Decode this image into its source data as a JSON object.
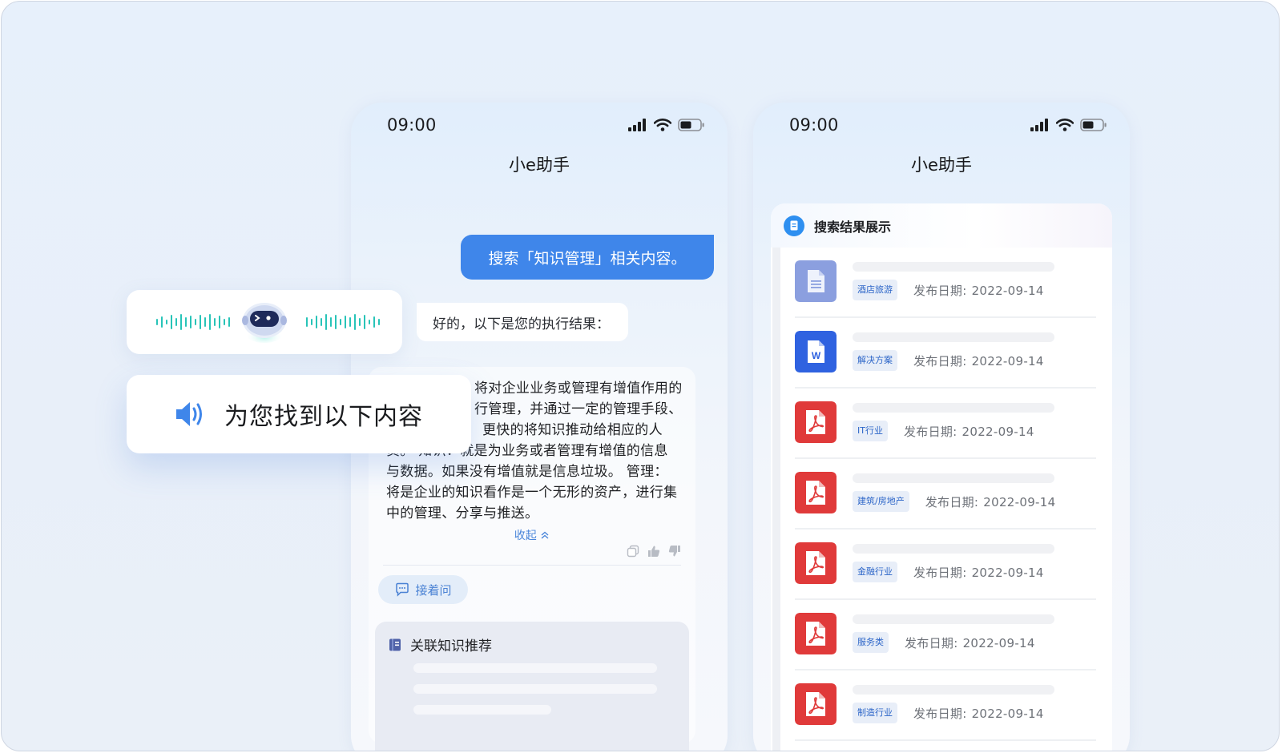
{
  "colors": {
    "accent": "#3f86ea",
    "pdf": "#e03a3a",
    "word": "#2f62e0",
    "doc": "#8aa0e0",
    "tag_text": "#2d66c8",
    "waveform": "#28c4b8"
  },
  "status_bar": {
    "time": "09:00"
  },
  "left_phone": {
    "title": "小e助手",
    "user_message": "搜索「知识管理」相关内容。",
    "bot_reply": "好的，以下是您的执行结果：",
    "answer_lines": [
      "将对企业业务或管理有增值作用的",
      "行管理，并通过一定的管理手段、",
      "更快的将知识推动给相应的人",
      "员。 知识：就是为业务或者管理有增值的信息",
      "与数据。如果没有增值就是信息垃圾。  管理：",
      "将是企业的知识看作是一个无形的资产，进行集",
      "中的管理、分享与推送。"
    ],
    "collapse_label": "收起",
    "follow_up_label": "接着问",
    "related_title": "关联知识推荐",
    "icons": [
      "copy-icon",
      "thumbs-up-icon",
      "thumbs-down-icon",
      "chat-icon",
      "book-icon"
    ]
  },
  "voice_overlay": {
    "icon": "robot-avatar",
    "tts_text": "为您找到以下内容",
    "tts_icon": "speaker-icon"
  },
  "right_phone": {
    "title": "小e助手",
    "section_title": "搜索结果展示",
    "date_label": "发布日期:",
    "results": [
      {
        "file_type": "doc",
        "icon": "document-icon",
        "tag": "酒店旅游",
        "date": "2022-09-14"
      },
      {
        "file_type": "word",
        "icon": "word-file-icon",
        "tag": "解决方案",
        "date": "2022-09-14"
      },
      {
        "file_type": "pdf",
        "icon": "pdf-file-icon",
        "tag": "IT行业",
        "date": "2022-09-14"
      },
      {
        "file_type": "pdf",
        "icon": "pdf-file-icon",
        "tag": "建筑/房地产",
        "date": "2022-09-14"
      },
      {
        "file_type": "pdf",
        "icon": "pdf-file-icon",
        "tag": "金融行业",
        "date": "2022-09-14"
      },
      {
        "file_type": "pdf",
        "icon": "pdf-file-icon",
        "tag": "服务类",
        "date": "2022-09-14"
      },
      {
        "file_type": "pdf",
        "icon": "pdf-file-icon",
        "tag": "制造行业",
        "date": "2022-09-14"
      }
    ]
  }
}
